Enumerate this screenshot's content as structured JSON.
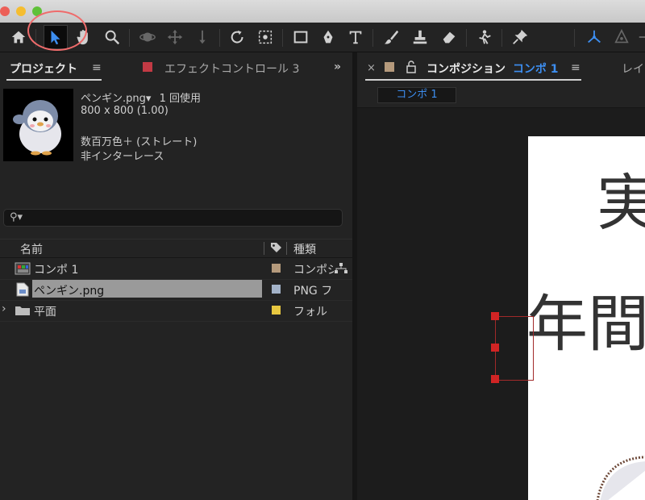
{
  "window": {
    "traffic_lights": [
      "close",
      "minimize",
      "zoom"
    ]
  },
  "toolbar": {
    "tools": [
      {
        "name": "home-icon",
        "active": false
      },
      {
        "name": "selection-tool-icon",
        "active": true
      },
      {
        "name": "hand-tool-icon",
        "active": false
      },
      {
        "name": "zoom-tool-icon",
        "active": false
      },
      {
        "name": "orbit-camera-icon",
        "active": false
      },
      {
        "name": "pan-camera-icon",
        "active": false
      },
      {
        "name": "dolly-camera-icon",
        "active": false
      },
      {
        "name": "rotate-tool-icon",
        "active": false
      },
      {
        "name": "pan-behind-tool-icon",
        "active": false
      },
      {
        "name": "rectangle-tool-icon",
        "active": false
      },
      {
        "name": "pen-tool-icon",
        "active": false
      },
      {
        "name": "type-tool-icon",
        "active": false
      },
      {
        "name": "brush-tool-icon",
        "active": false
      },
      {
        "name": "clone-stamp-tool-icon",
        "active": false
      },
      {
        "name": "eraser-tool-icon",
        "active": false
      },
      {
        "name": "roto-brush-tool-icon",
        "active": false
      },
      {
        "name": "puppet-pin-tool-icon",
        "active": false
      },
      {
        "name": "local-axis-icon",
        "active": false
      },
      {
        "name": "world-axis-icon",
        "active": false
      }
    ]
  },
  "project_panel": {
    "tab_label": "プロジェクト",
    "effects_tab_label": "エフェクトコントロール 3",
    "overflow": "»",
    "selected_item": {
      "title": "ペンギン.png",
      "dropdown": "▾",
      "usage": "1 回使用",
      "dimensions": "800 x 800 (1.00)",
      "color": "数百万色＋ (ストレート)",
      "field": "非インターレース"
    },
    "search": {
      "icon": "search-icon",
      "placeholder": ""
    },
    "columns": {
      "name": "名前",
      "label_icon": "label-tag-icon",
      "type": "種類"
    },
    "items": [
      {
        "icon": "composition-icon",
        "name": "コンポ 1",
        "type": "コンポジ",
        "label_color": "#b59a7c",
        "selected": false,
        "extra_icon": "flowchart-icon"
      },
      {
        "icon": "png-file-icon",
        "name": "ペンギン.png",
        "type": "PNG フ",
        "label_color": "#a3b2c8",
        "selected": true
      },
      {
        "icon": "folder-icon",
        "name": "平面",
        "type": "フォル",
        "label_color": "#e8c840",
        "selected": false,
        "expand": "›"
      }
    ]
  },
  "composition_panel": {
    "close": "×",
    "lock_icon": "lock-icon",
    "tab_prefix": "コンポジション",
    "tab_name": "コンポ 1",
    "next_tab_label": "レイ",
    "chip_label": "コンポ 1",
    "swatch_color": "#b59a7c",
    "canvas_text": [
      "実",
      "年間"
    ]
  },
  "colors": {
    "accent_blue": "#3d8ef0",
    "handle_red": "#d12424",
    "annotation_red": "#ef6b6b"
  }
}
